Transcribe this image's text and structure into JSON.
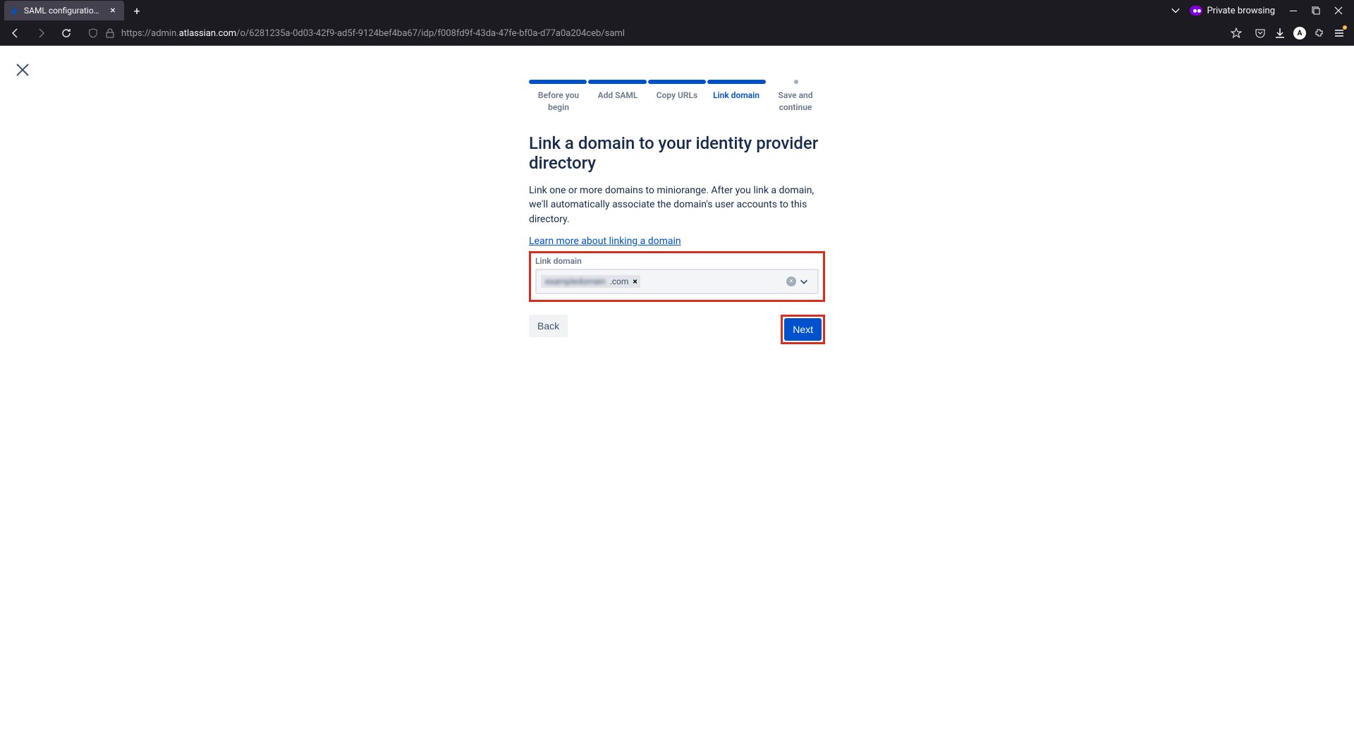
{
  "browser": {
    "tab_title": "SAML configuration - Cle",
    "private_label": "Private browsing",
    "url_prefix": "https://admin.",
    "url_domain": "atlassian.com",
    "url_path": "/o/6281235a-0d03-42f9-ad5f-9124bef4ba67/idp/f008fd9f-43da-47fe-bf0a-d77a0a204ceb/saml"
  },
  "steps": {
    "s1": "Before you begin",
    "s2": "Add SAML",
    "s3": "Copy URLs",
    "s4": "Link domain",
    "s5": "Save and continue"
  },
  "content": {
    "heading": "Link a domain to your identity provider directory",
    "description": "Link one or more domains to miniorange. After you link a domain, we'll automatically associate the domain's user accounts to this directory.",
    "learn_more": "Learn more about linking a domain",
    "field_label": "Link domain",
    "chip_blur": "exampledomain",
    "chip_suffix": ".com"
  },
  "buttons": {
    "back": "Back",
    "next": "Next"
  }
}
